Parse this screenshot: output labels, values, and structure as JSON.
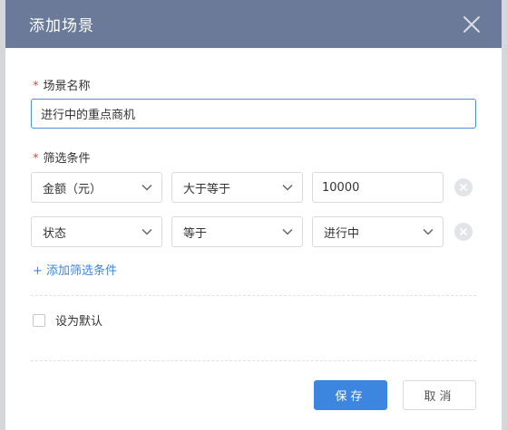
{
  "dialog": {
    "title": "添加场景",
    "close_icon": "close-icon"
  },
  "scene_name": {
    "required_mark": "*",
    "label": "场景名称",
    "value": "进行中的重点商机"
  },
  "filter": {
    "required_mark": "*",
    "label": "筛选条件",
    "rows": [
      {
        "field": "金额（元）",
        "operator": "大于等于",
        "value": "10000",
        "value_type": "input"
      },
      {
        "field": "状态",
        "operator": "等于",
        "value": "进行中",
        "value_type": "select"
      }
    ],
    "add_label": "+ 添加筛选条件"
  },
  "default_option": {
    "label": "设为默认",
    "checked": false
  },
  "buttons": {
    "save": "保存",
    "cancel": "取消"
  },
  "colors": {
    "header": "#6b7a99",
    "primary": "#3d86e0",
    "required": "#e0483b"
  }
}
